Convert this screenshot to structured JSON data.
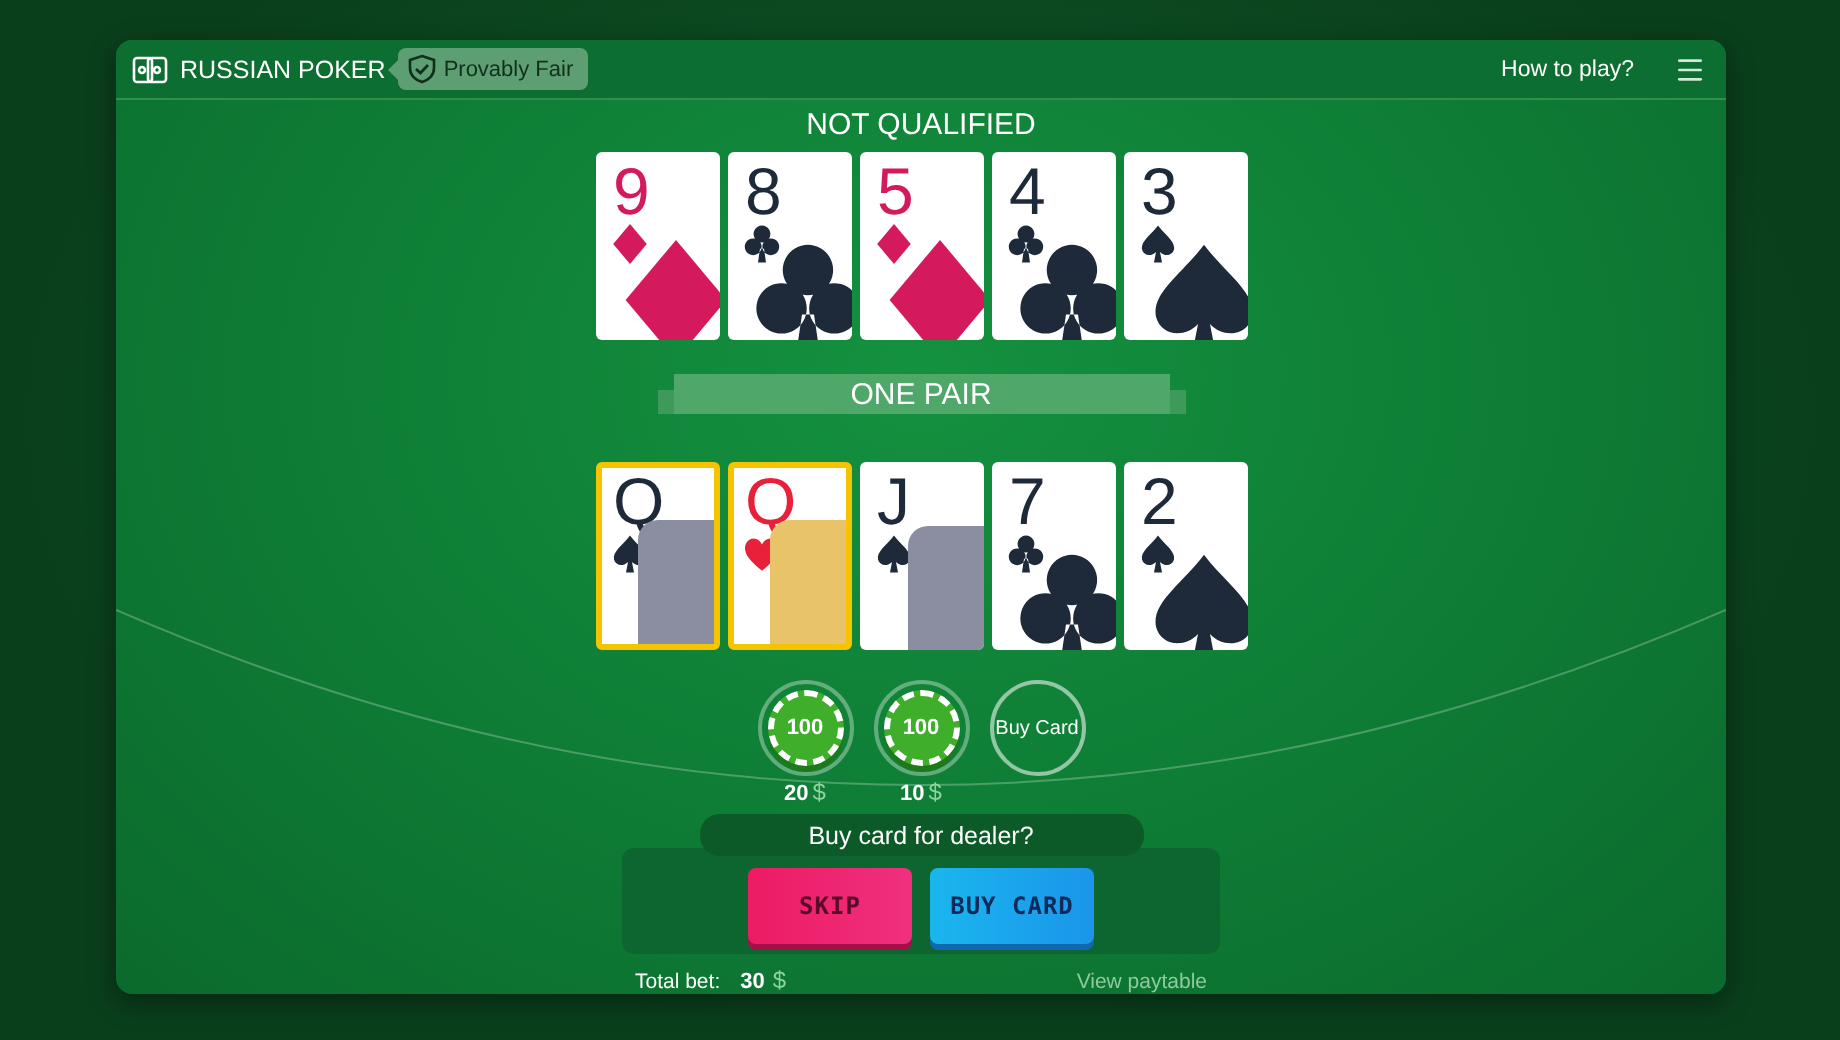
{
  "header": {
    "title": "RUSSIAN POKER",
    "badge": "Provably Fair",
    "help_link": "How to play?"
  },
  "dealer": {
    "status": "NOT QUALIFIED",
    "cards": [
      {
        "rank": "9",
        "kind": "diamonds",
        "portrait": false,
        "selected": false
      },
      {
        "rank": "8",
        "kind": "clubs",
        "portrait": false,
        "selected": false
      },
      {
        "rank": "5",
        "kind": "diamonds",
        "portrait": false,
        "selected": false
      },
      {
        "rank": "4",
        "kind": "clubs",
        "portrait": false,
        "selected": false
      },
      {
        "rank": "3",
        "kind": "spades",
        "portrait": false,
        "selected": false
      }
    ]
  },
  "hand_name": "ONE PAIR",
  "player": {
    "cards": [
      {
        "rank": "Q",
        "kind": "spades",
        "portrait": true,
        "selected": true
      },
      {
        "rank": "Q",
        "kind": "hearts",
        "portrait": true,
        "selected": true
      },
      {
        "rank": "J",
        "kind": "spades",
        "portrait": true,
        "selected": false
      },
      {
        "rank": "7",
        "kind": "clubs",
        "portrait": false,
        "selected": false
      },
      {
        "rank": "2",
        "kind": "spades",
        "portrait": false,
        "selected": false
      }
    ]
  },
  "chips": [
    {
      "value": "100",
      "amount": "20",
      "currency": "$"
    },
    {
      "value": "100",
      "amount": "10",
      "currency": "$"
    }
  ],
  "buy_card_chip": "Buy Card",
  "prompt": "Buy card for dealer?",
  "actions": [
    {
      "label": "SKIP",
      "kind": "skip"
    },
    {
      "label": "BUY CARD",
      "kind": "buy"
    }
  ],
  "footer": {
    "total_label": "Total bet:",
    "total_amount": "30",
    "currency": "$",
    "paytable_link": "View paytable"
  }
}
